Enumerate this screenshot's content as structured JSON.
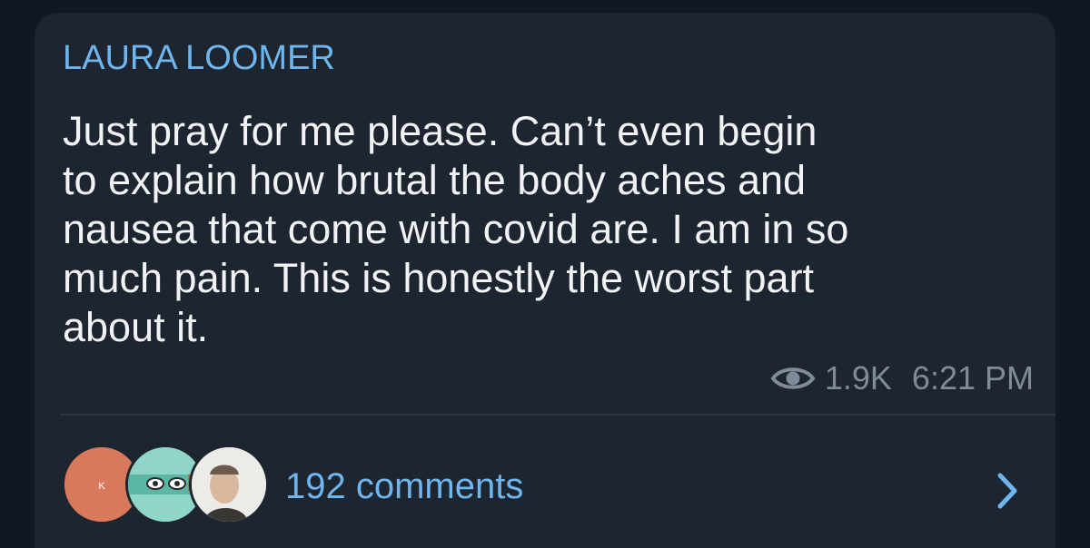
{
  "post": {
    "sender": "LAURA LOOMER",
    "lines": [
      "Just pray for me please. Can’t even begin",
      "to explain how brutal the body aches and",
      "nausea that come with covid are. I am in so",
      "much pain. This is honestly the worst part",
      "about it."
    ],
    "views": "1.9K",
    "time": "6:21 PM",
    "view_icon": "eye-icon"
  },
  "comments": {
    "label": "192 comments",
    "avatar_initial": "K",
    "chevron_icon": "chevron-right-icon"
  },
  "colors": {
    "accent": "#6fb5ee",
    "bubble": "#1d2530",
    "background": "#111821",
    "text": "#f1f3f5",
    "meta": "#7f8b98"
  }
}
